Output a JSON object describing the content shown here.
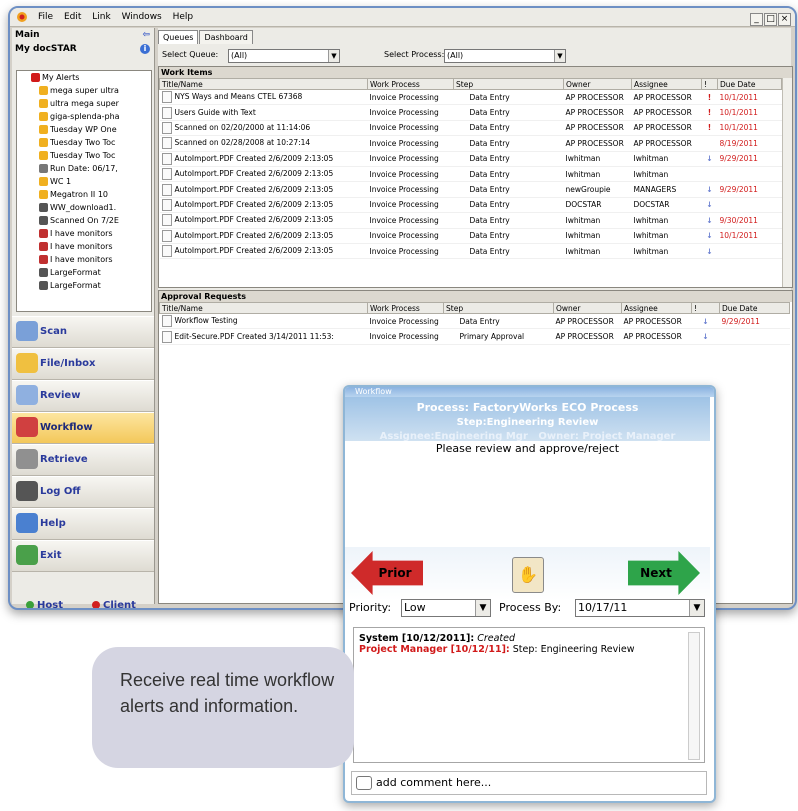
{
  "menu": [
    "File",
    "Edit",
    "Link",
    "Windows",
    "Help"
  ],
  "window_controls": [
    "_",
    "×"
  ],
  "left": {
    "main_label": "Main",
    "section_label": "My docSTAR",
    "tree_items": [
      "My Alerts",
      "mega super ultra",
      "ultra mega super",
      "giga-splenda-pha",
      "Tuesday WP One",
      "Tuesday Two Toc",
      "Tuesday Two Toc",
      "Run Date: 06/17,",
      "WC 1",
      "Megatron II 10",
      "WW_download1.",
      "Scanned On 7/2E",
      "I have monitors",
      "I have monitors",
      "I have monitors",
      "LargeFormat",
      "LargeFormat"
    ],
    "nav": [
      "Scan",
      "File/Inbox",
      "Review",
      "Workflow",
      "Retrieve",
      "Log Off",
      "Help",
      "Exit"
    ],
    "status": {
      "host": "Host",
      "client": "Client"
    }
  },
  "tabs": [
    "Queues",
    "Dashboard"
  ],
  "filters": {
    "queue_label": "Select Queue:",
    "queue_value": "(All)",
    "process_label": "Select Process:",
    "process_value": "(All)"
  },
  "work_items": {
    "title": "Work Items",
    "columns": [
      "Title/Name",
      "Work Process",
      "Step",
      "Owner",
      "Assignee",
      "!",
      "Due Date"
    ],
    "rows": [
      [
        "NYS Ways and Means CTEL 67368",
        "Invoice Processing",
        "Data Entry",
        "AP PROCESSOR",
        "AP PROCESSOR",
        "!",
        "10/1/2011"
      ],
      [
        "Users Guide with Text",
        "Invoice Processing",
        "Data Entry",
        "AP PROCESSOR",
        "AP PROCESSOR",
        "!",
        "10/1/2011"
      ],
      [
        "Scanned on 02/20/2000 at 11:14:06",
        "Invoice Processing",
        "Data Entry",
        "AP PROCESSOR",
        "AP PROCESSOR",
        "!",
        "10/1/2011"
      ],
      [
        "Scanned on 02/28/2008 at 10:27:14",
        "Invoice Processing",
        "Data Entry",
        "AP PROCESSOR",
        "AP PROCESSOR",
        "",
        "8/19/2011"
      ],
      [
        "AutoImport.PDF Created 2/6/2009 2:13:05",
        "Invoice Processing",
        "Data Entry",
        "Iwhitman",
        "Iwhitman",
        "↓",
        "9/29/2011"
      ],
      [
        "AutoImport.PDF Created 2/6/2009 2:13:05",
        "Invoice Processing",
        "Data Entry",
        "Iwhitman",
        "Iwhitman",
        "",
        ""
      ],
      [
        "AutoImport.PDF Created 2/6/2009 2:13:05",
        "Invoice Processing",
        "Data Entry",
        "newGroupie",
        "MANAGERS",
        "↓",
        "9/29/2011"
      ],
      [
        "AutoImport.PDF Created 2/6/2009 2:13:05",
        "Invoice Processing",
        "Data Entry",
        "DOCSTAR",
        "DOCSTAR",
        "↓",
        ""
      ],
      [
        "AutoImport.PDF Created 2/6/2009 2:13:05",
        "Invoice Processing",
        "Data Entry",
        "Iwhitman",
        "Iwhitman",
        "↓",
        "9/30/2011"
      ],
      [
        "AutoImport.PDF Created 2/6/2009 2:13:05",
        "Invoice Processing",
        "Data Entry",
        "Iwhitman",
        "Iwhitman",
        "↓",
        "10/1/2011"
      ],
      [
        "AutoImport.PDF Created 2/6/2009 2:13:05",
        "Invoice Processing",
        "Data Entry",
        "Iwhitman",
        "Iwhitman",
        "↓",
        ""
      ]
    ]
  },
  "approval": {
    "title": "Approval Requests",
    "columns": [
      "Title/Name",
      "Work Process",
      "Step",
      "Owner",
      "Assignee",
      "!",
      "Due Date"
    ],
    "rows": [
      [
        "Workflow Testing",
        "Invoice Processing",
        "Data Entry",
        "AP PROCESSOR",
        "AP PROCESSOR",
        "↓",
        "9/29/2011"
      ],
      [
        "Edit-Secure.PDF Created 3/14/2011 11:53:",
        "Invoice Processing",
        "Primary Approval",
        "AP PROCESSOR",
        "AP PROCESSOR",
        "↓",
        ""
      ]
    ]
  },
  "workflow_popup": {
    "window_title": "Workflow",
    "process": "Process: FactoryWorks ECO Process",
    "step": "Step:Engineering Review",
    "assignee": "Assignee:Engineering Mgr",
    "owner": "Owner: Project Manager",
    "message": "Please review and approve/reject",
    "prior_label": "Prior",
    "next_label": "Next",
    "priority_label": "Priority:",
    "priority_value": "Low",
    "process_by_label": "Process By:",
    "process_by_value": "10/17/11",
    "log": [
      {
        "who": "System [10/12/2011]:",
        "what": "Created"
      },
      {
        "who": "Project Manager [10/12/11]:",
        "what": "Step: Engineering Review"
      }
    ],
    "comment_placeholder": "add comment here..."
  },
  "callout": "Receive real time workflow alerts and information.",
  "colors": {
    "frame": "#6d8fc4",
    "alert_red": "#d11a1a",
    "nav_text": "#2a3a9c",
    "popup_blue": "#9fc3e6"
  }
}
